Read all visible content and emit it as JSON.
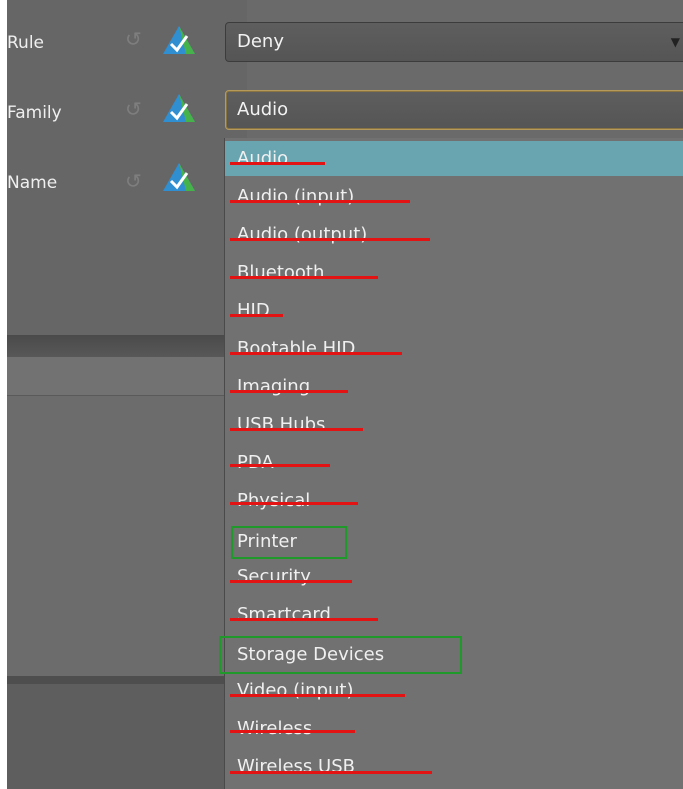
{
  "fields": [
    {
      "label": "Rule",
      "value": "Deny"
    },
    {
      "label": "Family",
      "value": "Audio"
    },
    {
      "label": "Name"
    }
  ],
  "icons": {
    "reset": "reset-icon",
    "validate": "triangle-check-icon"
  },
  "dropdown": {
    "options": [
      {
        "label": "Audio",
        "selected": true,
        "struck": true
      },
      {
        "label": "Audio (input)",
        "struck": true
      },
      {
        "label": "Audio (output)",
        "struck": true
      },
      {
        "label": "Bluetooth",
        "struck": true
      },
      {
        "label": "HID",
        "struck": true
      },
      {
        "label": "Bootable HID",
        "struck": true
      },
      {
        "label": "Imaging",
        "struck": true
      },
      {
        "label": "USB Hubs",
        "struck": true
      },
      {
        "label": "PDA",
        "struck": true
      },
      {
        "label": "Physical",
        "struck": true
      },
      {
        "label": "Printer",
        "highlighted": true
      },
      {
        "label": "Security",
        "struck": true
      },
      {
        "label": "Smartcard",
        "struck": true
      },
      {
        "label": "Storage Devices",
        "highlighted": true
      },
      {
        "label": "Video (input)",
        "struck": true
      },
      {
        "label": "Wireless",
        "struck": true
      },
      {
        "label": "Wireless USB",
        "struck": true
      }
    ]
  },
  "colors": {
    "strike": "#e31313",
    "highlight_box": "#1f9a2a",
    "selection": "#69a4b1"
  }
}
